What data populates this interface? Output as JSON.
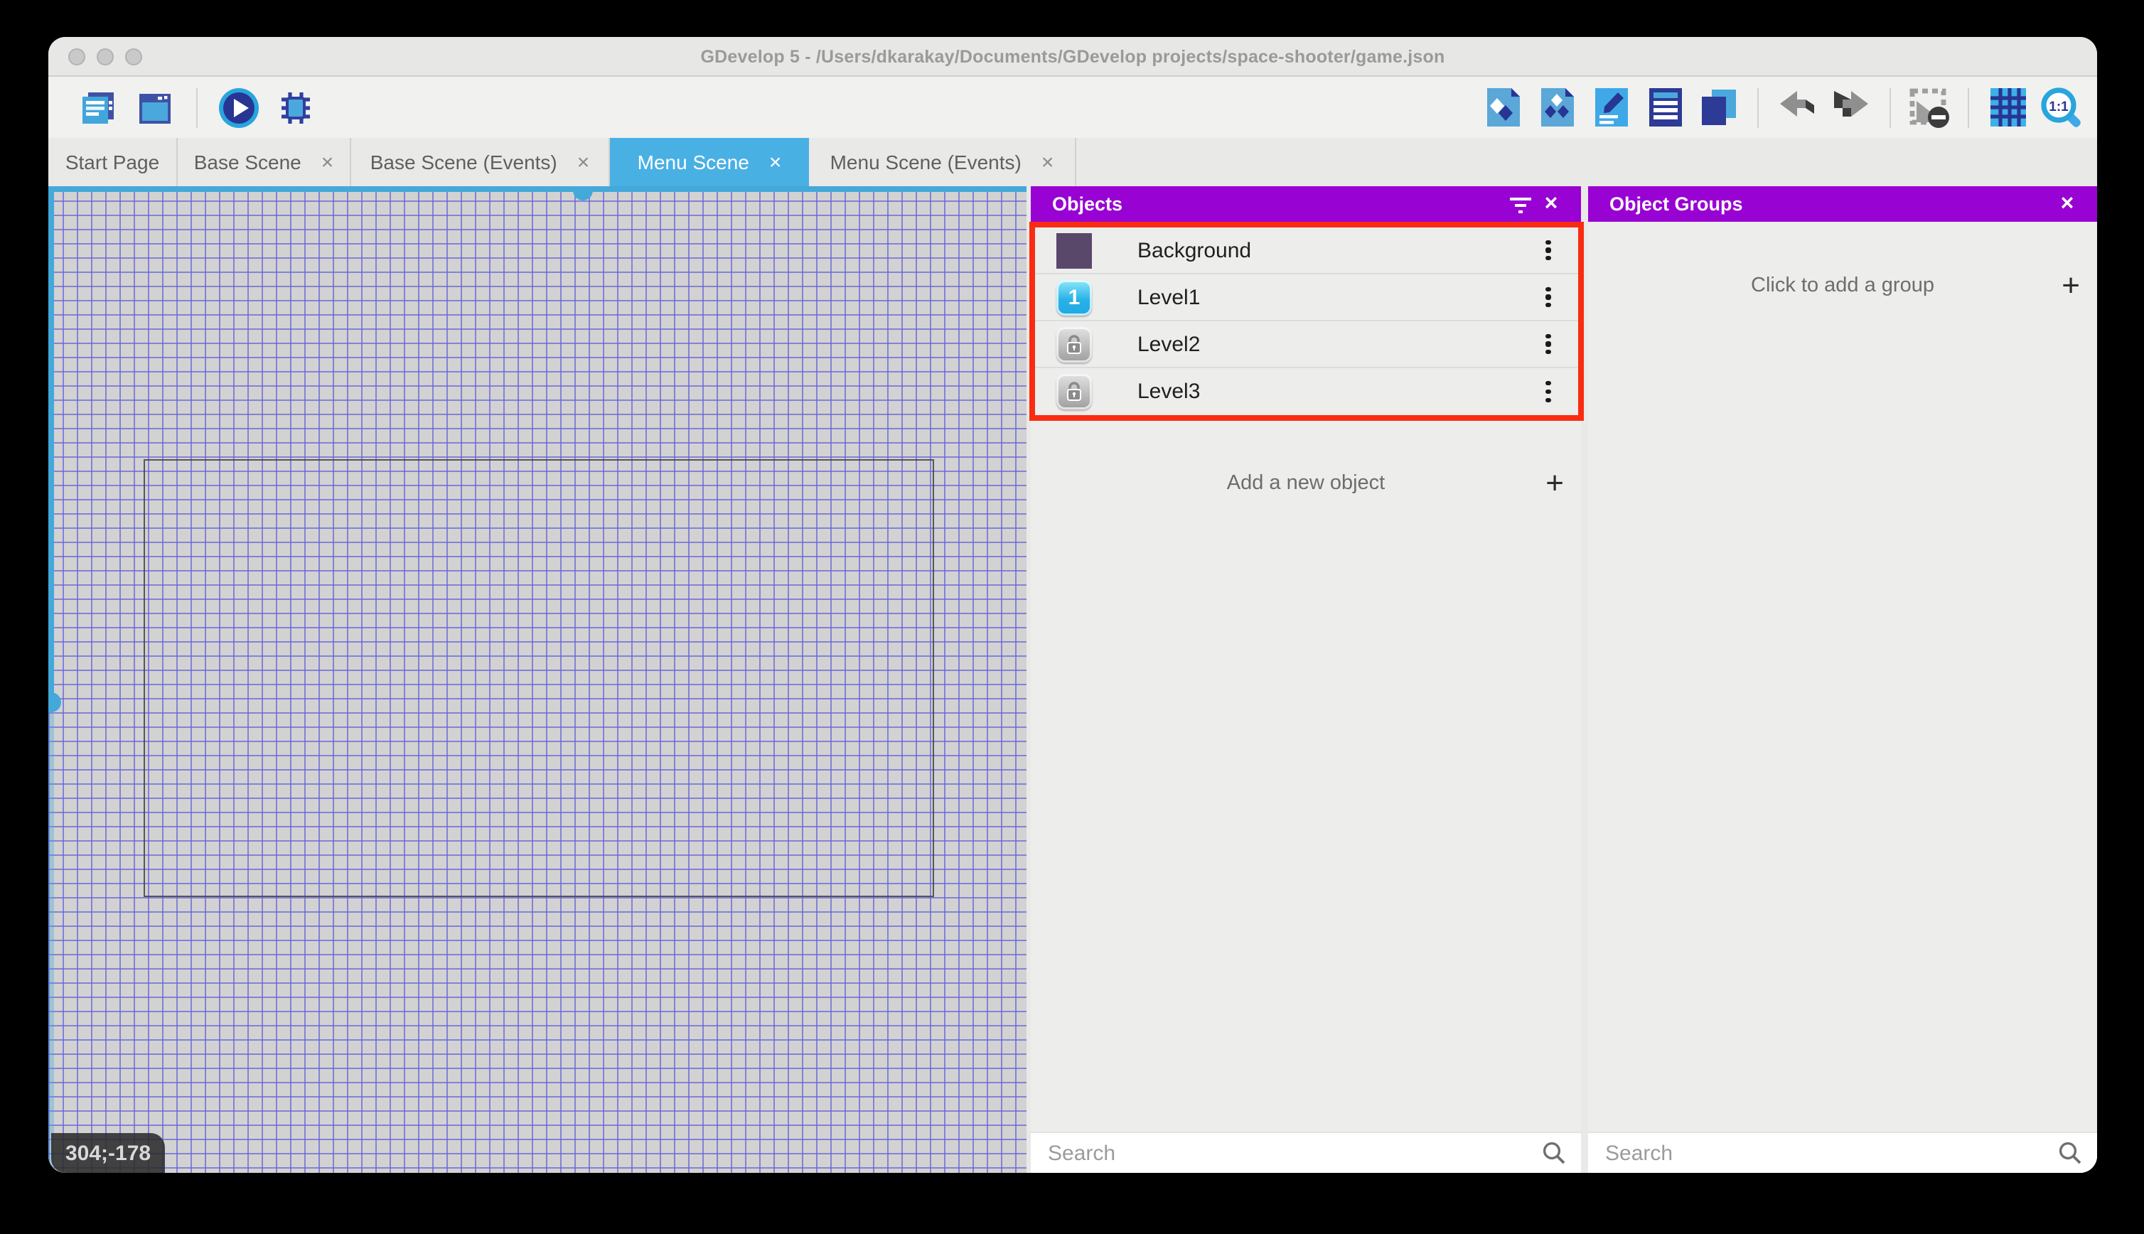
{
  "window": {
    "title": "GDevelop 5 - /Users/dkarakay/Documents/GDevelop projects/space-shooter/game.json"
  },
  "toolbar": {
    "left_buttons": [
      {
        "id": "project-manager",
        "icon": "project-manager-icon"
      },
      {
        "id": "scene-properties",
        "icon": "scene-window-icon"
      },
      {
        "id": "preview",
        "icon": "play-icon"
      },
      {
        "id": "debug",
        "icon": "debug-bug-icon"
      }
    ],
    "right_buttons": [
      {
        "id": "objects-editor",
        "icon": "object-page-icon"
      },
      {
        "id": "object-groups-editor",
        "icon": "object-groups-page-icon"
      },
      {
        "id": "properties",
        "icon": "properties-pencil-icon"
      },
      {
        "id": "instances-list",
        "icon": "instances-list-icon"
      },
      {
        "id": "layers",
        "icon": "layers-icon"
      },
      {
        "id": "undo",
        "icon": "undo-arrow-icon"
      },
      {
        "id": "redo",
        "icon": "redo-arrow-icon"
      },
      {
        "id": "toggle-window-mask",
        "icon": "window-mask-icon"
      },
      {
        "id": "toggle-grid",
        "icon": "grid-icon"
      },
      {
        "id": "zoom-original",
        "icon": "zoom-1-1-icon",
        "label": "1:1"
      }
    ]
  },
  "tabs": [
    {
      "label": "Start Page",
      "active": false,
      "closable": false
    },
    {
      "label": "Base Scene",
      "active": false,
      "closable": true
    },
    {
      "label": "Base Scene (Events)",
      "active": false,
      "closable": true
    },
    {
      "label": "Menu Scene",
      "active": true,
      "closable": true
    },
    {
      "label": "Menu Scene (Events)",
      "active": false,
      "closable": true
    }
  ],
  "close_glyph": "×",
  "canvas": {
    "coordinate_badge": "304;-178"
  },
  "objects_panel": {
    "title": "Objects",
    "objects": [
      {
        "name": "Background",
        "icon": "purple-sprite-thumbnail",
        "badge": ""
      },
      {
        "name": "Level1",
        "icon": "level1-button-thumbnail",
        "badge": "1"
      },
      {
        "name": "Level2",
        "icon": "locked-button-thumbnail",
        "badge": ""
      },
      {
        "name": "Level3",
        "icon": "locked-button-thumbnail",
        "badge": ""
      }
    ],
    "add_button_label": "Add a new object",
    "search_placeholder": "Search"
  },
  "object_groups_panel": {
    "title": "Object Groups",
    "add_group_label": "Click to add a group",
    "search_placeholder": "Search"
  },
  "colors": {
    "panel_header_purple": "#9802d2",
    "active_tab_blue": "#49b0e4",
    "highlight_red": "#f92c12",
    "scrollbar_blue": "#43a8da",
    "canvas_grid_line": "#6763d8"
  }
}
